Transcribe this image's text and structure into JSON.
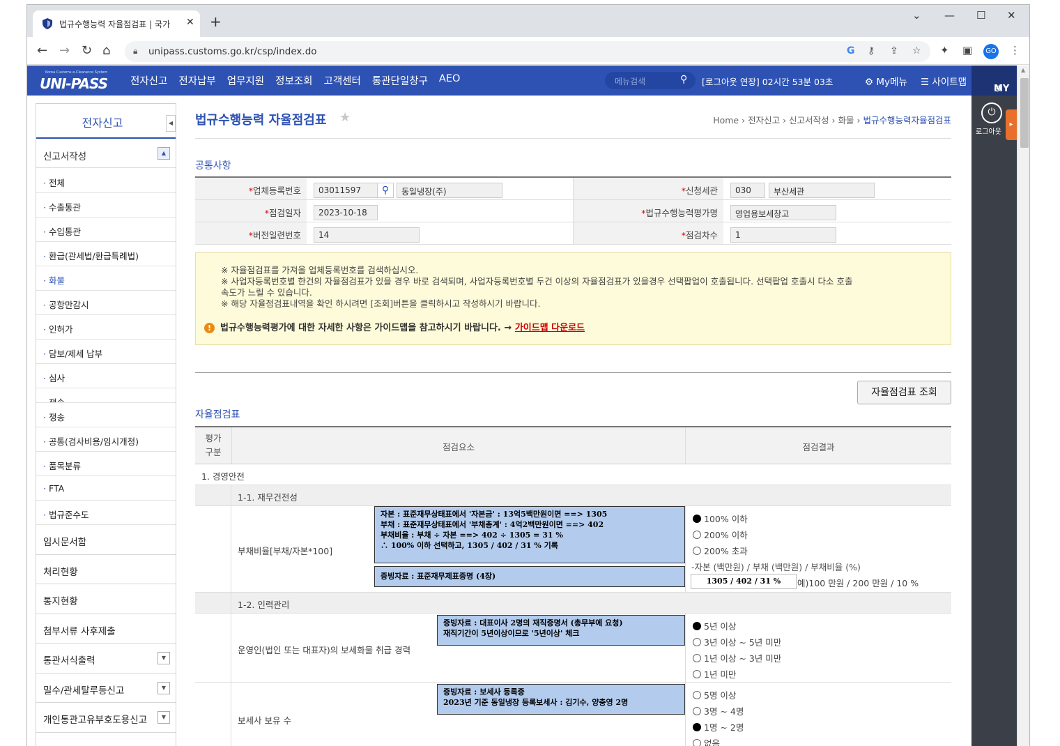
{
  "browser": {
    "tab_title": "법규수행능력 자율점검표 | 국가",
    "url": "unipass.customs.go.kr/csp/index.do",
    "profile": "GO"
  },
  "header": {
    "logo_small": "Korea Customs e-Clearance System",
    "logo": "UNI-PASS",
    "menu": [
      "전자신고",
      "전자납부",
      "업무지원",
      "정보조회",
      "고객센터",
      "통관단일창구",
      "AEO"
    ],
    "search_placeholder": "메뉴검색",
    "session": "[로그아웃 연장] 02시간 53분 03초",
    "my_menu": "My메뉴",
    "sitemap": "사이트맵",
    "my": "MY",
    "logout": "로그아웃"
  },
  "sidebar": {
    "title": "전자신고",
    "section": "신고서작성",
    "items": [
      "전체",
      "수출통관",
      "수입통관",
      "환급(관세법/환급특례법)",
      "화물",
      "공항만감시",
      "인허가",
      "담보/제세 납부",
      "심사",
      "쟁송",
      "쟁송",
      "공통(검사비용/임시개청)",
      "품목분류",
      "FTA",
      "법규준수도"
    ],
    "main_items": [
      "임시문서함",
      "처리현황",
      "통지현황",
      "첨부서류 사후제출",
      "통관서식출력",
      "밀수/관세탈루등신고",
      "개인통관고유부호도용신고"
    ]
  },
  "page": {
    "title": "법규수행능력 자율점검표",
    "breadcrumb": [
      "Home",
      "전자신고",
      "신고서작성",
      "화물"
    ],
    "breadcrumb_current": "법규수행능력자율점검표",
    "common_section": "공통사항",
    "form": {
      "biz_no_label": "업체등록번호",
      "biz_no": "03011597",
      "biz_name": "동일냉장(주)",
      "customs_label": "신청세관",
      "customs_code": "030",
      "customs_name": "부산세관",
      "check_date_label": "점검일자",
      "check_date": "2023-10-18",
      "eval_name_label": "법규수행능력평가명",
      "eval_name": "영업용보세창고",
      "version_label": "버전일련번호",
      "version": "14",
      "round_label": "점검차수",
      "round": "1"
    },
    "notice": {
      "line1": "※ 자율점검표를 가져올 업체등록번호를 검색하십시오.",
      "line2": "※ 사업자등록번호별 한건의 자율점검표가 있을 경우 바로 검색되며, 사업자등록번호별 두건 이상의 자율점검표가 있을경우 선택팝업이 호출됩니다. 선택팝업 호출시 다소 호출",
      "line3": "속도가 느릴 수 있습니다.",
      "line4": "※ 해당 자율점검표내역을 확인 하시려면 [조회]버튼을 클릭하시고 작성하시기 바랍니다.",
      "guide": "법규수행능력평가에 대한 자세한 사항은 가이드맵을 참고하시기 바랍니다. →",
      "guide_link": "가이드맵 다운로드"
    },
    "query_button": "자율점검표 조회",
    "check_section": "자율점검표",
    "table": {
      "col1_a": "평가",
      "col1_b": "구분",
      "col2": "점검요소",
      "col3": "점검결과",
      "group1": "1. 경영안전",
      "sub1": "1-1. 재무건전성",
      "item1": {
        "label": "부채비율[부채/자본*100]",
        "note1": [
          "자본 : 표준재무상태표에서 '자본금' : 13억5백만원이면 ==> 1305",
          "부채 : 표준재무상태표에서 '부채총계' : 4억2백만원이면 ==> 402",
          "부채비율 : 부채 ÷ 자본 ==> 402 ÷ 1305 = 31 %",
          "∴ 100% 이하 선택하고, 1305 / 402 / 31 % 기록"
        ],
        "note2": "증빙자료 : 표준재무제표증명 (4장)",
        "options": [
          "100% 이하",
          "200% 이하",
          "200% 초과"
        ],
        "selected": 0,
        "hint": "-자본 (백만원) / 부채 (백만원) / 부채비율 (%)",
        "input": "1305 / 402 / 31 %",
        "example": "예)100 만원 / 200 만원 / 10 %"
      },
      "sub2": "1-2. 인력관리",
      "item2": {
        "label": "운영인(법인 또는 대표자)의 보세화물 취급 경력",
        "note": [
          "증빙자료 : 대표이사 2명의 재직증명서 (총무부에 요청)",
          "재직기간이 5년이상이므로 '5년이상' 체크"
        ],
        "options": [
          "5년 이상",
          "3년 이상 ~ 5년 미만",
          "1년 이상 ~ 3년 미만",
          "1년 미만"
        ],
        "selected": 0
      },
      "item3": {
        "label": "보세사 보유 수",
        "note": [
          "증빙자료 : 보세사 등록증",
          "2023년 기준 동일냉장 등록보세사 : 김기수, 양충영 2명"
        ],
        "options": [
          "5명 이상",
          "3명 ~ 4명",
          "1명 ~ 2명",
          "없음"
        ],
        "selected": 2
      }
    }
  }
}
